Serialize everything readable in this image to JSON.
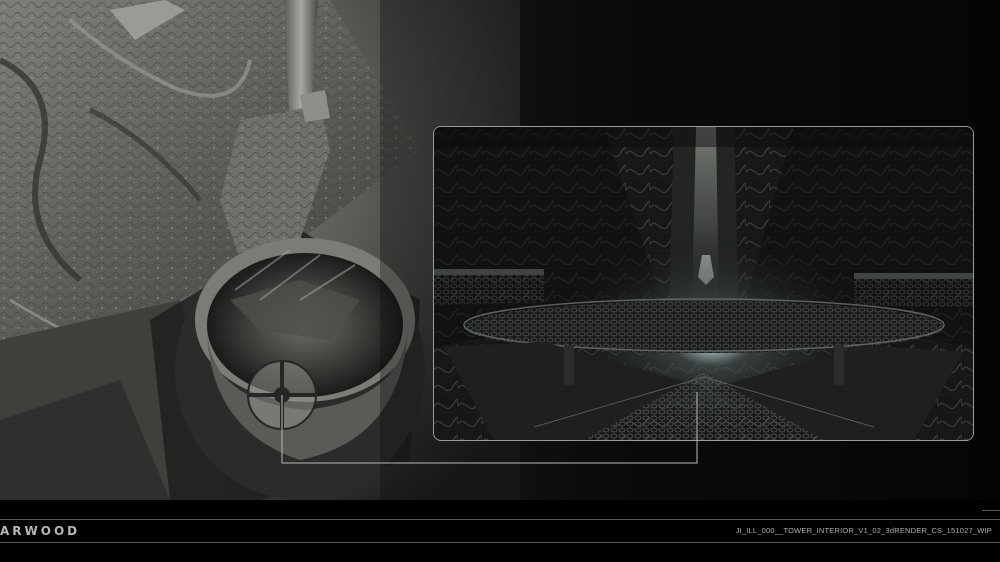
{
  "footer": {
    "studio_name": "ARWOOD",
    "file_label": "JI_ILL_000__TOWER_INTERIOR_V1_02_3dRENDER_CS_151027_WIP"
  },
  "colors": {
    "background_left": "#262824",
    "background_right": "#050505",
    "inset_border": "#9c9c94",
    "callout_line": "#b9b9b2",
    "info_bar": "#000000",
    "text": "#b7b7b7"
  }
}
